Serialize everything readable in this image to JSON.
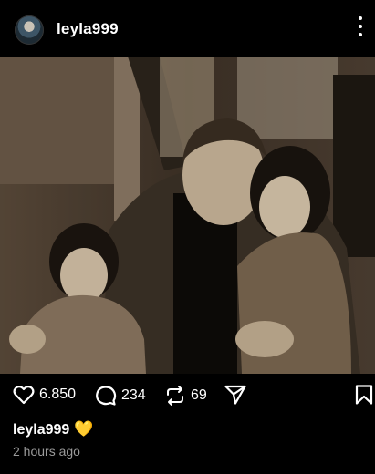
{
  "post": {
    "username": "leyla999",
    "likes": "6.850",
    "comments": "234",
    "reposts": "69",
    "caption_user": "leyla999",
    "caption_emoji": "💛",
    "timestamp": "2 hours ago"
  },
  "icons": {
    "avatar": "profile-avatar",
    "more": "more-options-icon",
    "like": "heart-icon",
    "comment": "comment-icon",
    "repost": "repost-icon",
    "share": "send-icon",
    "save": "bookmark-icon"
  },
  "colors": {
    "background": "#000000",
    "text": "#ffffff",
    "muted": "#9a9a9a",
    "emoji_heart": "#f2c12e"
  }
}
